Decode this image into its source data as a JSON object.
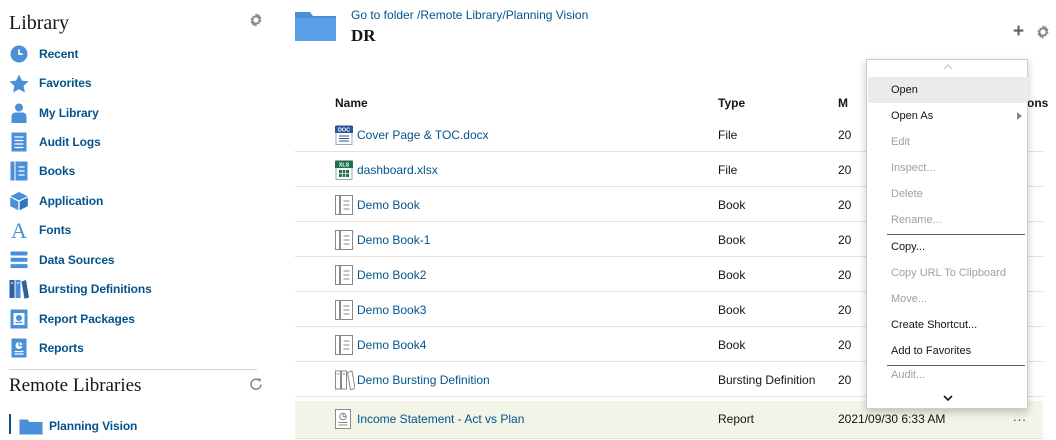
{
  "sidebar": {
    "title": "Library",
    "items": [
      {
        "label": "Recent",
        "icon": "clock-icon"
      },
      {
        "label": "Favorites",
        "icon": "star-icon"
      },
      {
        "label": "My Library",
        "icon": "person-icon"
      },
      {
        "label": "Audit Logs",
        "icon": "document-lines-icon"
      },
      {
        "label": "Books",
        "icon": "book-icon"
      },
      {
        "label": "Application",
        "icon": "cube-icon"
      },
      {
        "label": "Fonts",
        "icon": "font-icon"
      },
      {
        "label": "Data Sources",
        "icon": "database-icon"
      },
      {
        "label": "Bursting Definitions",
        "icon": "binders-icon"
      },
      {
        "label": "Report Packages",
        "icon": "report-package-icon"
      },
      {
        "label": "Reports",
        "icon": "report-icon"
      }
    ],
    "remote_title": "Remote Libraries",
    "remote_items": [
      {
        "label": "Planning Vision",
        "icon": "folder-icon"
      }
    ]
  },
  "header": {
    "breadcrumb": "Go to folder /Remote Library/Planning Vision",
    "title": "DR",
    "add_label": "+"
  },
  "table": {
    "columns": {
      "name": "Name",
      "type": "Type",
      "modified": "M",
      "actions": "ons"
    },
    "rows": [
      {
        "name": "Cover Page & TOC.docx",
        "type": "File",
        "modified": "20",
        "icon": "docx-file-icon",
        "icon_label": "DOC"
      },
      {
        "name": "dashboard.xlsx",
        "type": "File",
        "modified": "20",
        "icon": "xlsx-file-icon",
        "icon_label": "XLS"
      },
      {
        "name": "Demo Book",
        "type": "Book",
        "modified": "20",
        "icon": "book-icon"
      },
      {
        "name": "Demo Book-1",
        "type": "Book",
        "modified": "20",
        "icon": "book-icon"
      },
      {
        "name": "Demo Book2",
        "type": "Book",
        "modified": "20",
        "icon": "book-icon"
      },
      {
        "name": "Demo Book3",
        "type": "Book",
        "modified": "20",
        "icon": "book-icon"
      },
      {
        "name": "Demo Book4",
        "type": "Book",
        "modified": "20",
        "icon": "book-icon"
      },
      {
        "name": "Demo Bursting Definition",
        "type": "Bursting Definition",
        "modified": "20",
        "icon": "bursting-definition-icon"
      },
      {
        "name": "Income Statement - Act vs Plan",
        "type": "Report",
        "modified": "2021/09/30 6:33 AM",
        "icon": "report-icon",
        "actions": "..."
      }
    ]
  },
  "context_menu": {
    "items": [
      {
        "label": "Open",
        "enabled": true,
        "active": true
      },
      {
        "label": "Open As",
        "enabled": true,
        "submenu": true
      },
      {
        "label": "Edit",
        "enabled": false
      },
      {
        "label": "Inspect...",
        "enabled": false
      },
      {
        "label": "Delete",
        "enabled": false
      },
      {
        "label": "Rename...",
        "enabled": false
      },
      {
        "label": "Copy...",
        "enabled": true
      },
      {
        "label": "Copy URL To Clipboard",
        "enabled": false
      },
      {
        "label": "Move...",
        "enabled": false
      },
      {
        "label": "Create Shortcut...",
        "enabled": true
      },
      {
        "label": "Add to Favorites",
        "enabled": true
      },
      {
        "label": "Audit...",
        "enabled": false
      }
    ]
  },
  "colors": {
    "link": "#04538c",
    "folder": "#4a90d9",
    "highlight_row": "#f1f4e6",
    "menu_active": "#ebebeb"
  }
}
